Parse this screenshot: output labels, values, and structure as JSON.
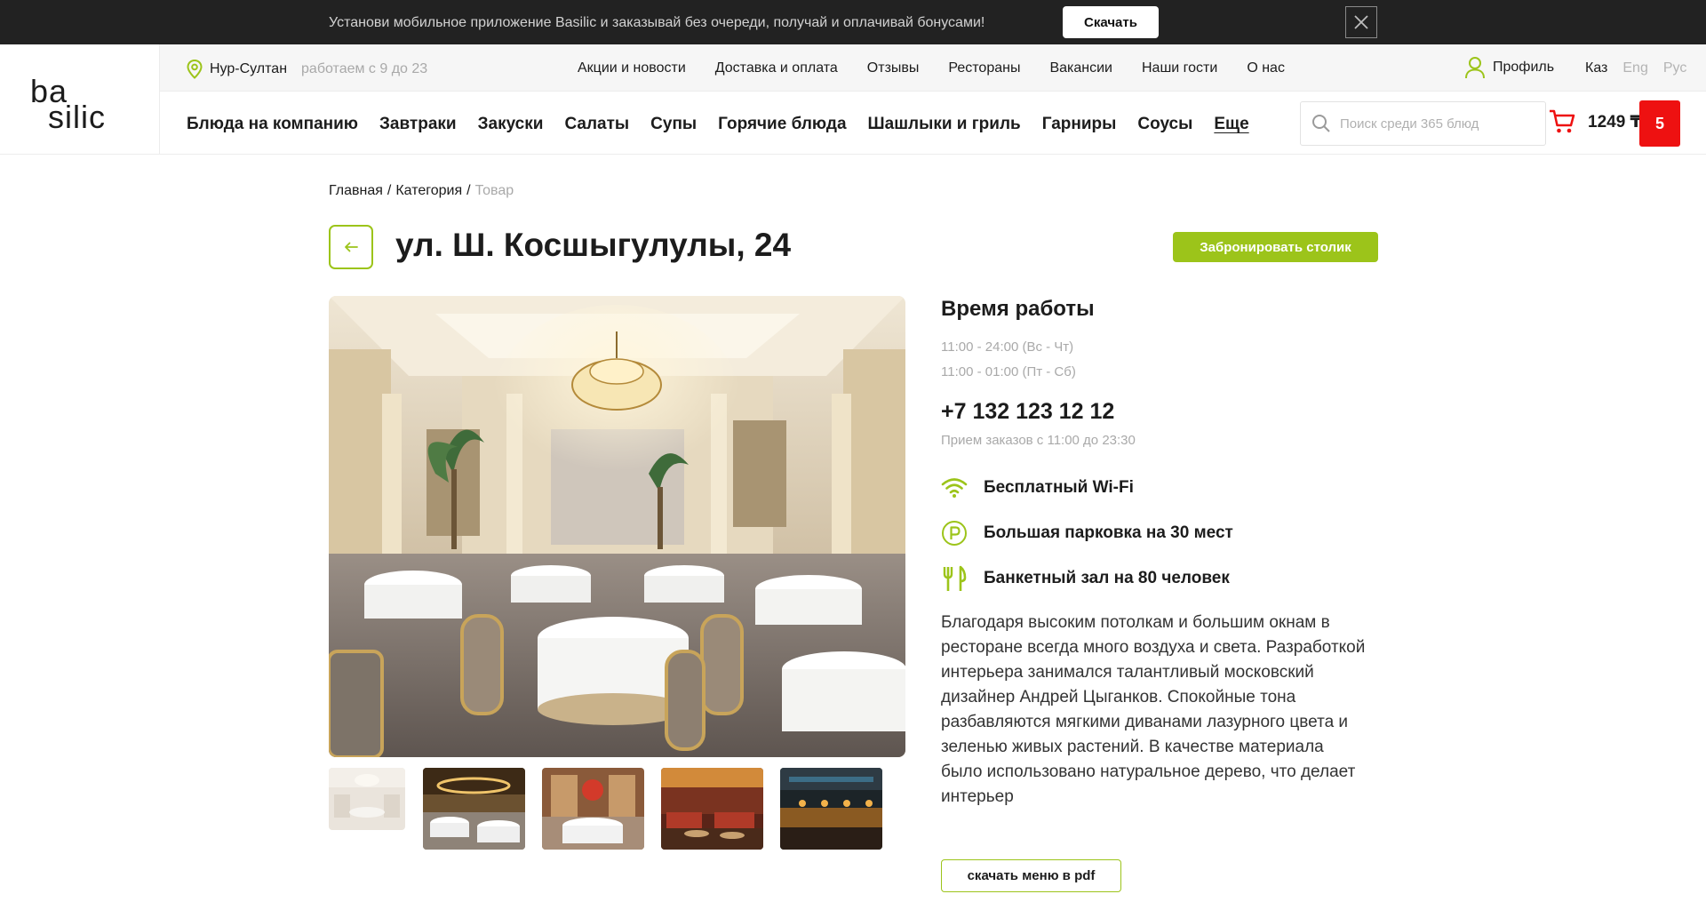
{
  "promo": {
    "text": "Установи мобильное приложение Basilic и заказывай без очереди, получай и оплачивай бонусами!",
    "button_label": "Скачать",
    "close_icon": "close-icon"
  },
  "logo": {
    "line1": "ba",
    "line2": "silic"
  },
  "topbar": {
    "city": "Нур-Султан",
    "hours": "работаем с 9 до 23",
    "nav": [
      "Акции и новости",
      "Доставка и оплата",
      "Отзывы",
      "Рестораны",
      "Вакансии",
      "Наши гости",
      "О нас"
    ],
    "profile_label": "Профиль",
    "languages": [
      "Каз",
      "Eng",
      "Рус"
    ],
    "active_language": "Каз"
  },
  "mainbar": {
    "categories": [
      "Блюда на компанию",
      "Завтраки",
      "Закуски",
      "Салаты",
      "Супы",
      "Горячие блюда",
      "Шашлыки и гриль",
      "Гарниры",
      "Соусы"
    ],
    "more_label": "Еще",
    "search_placeholder": "Поиск среди 365 блюд",
    "cart_sum": "1249 ₸",
    "cart_count": "5"
  },
  "breadcrumb": {
    "items": [
      "Главная",
      "Категория"
    ],
    "current": "Товар",
    "separator": "/"
  },
  "page": {
    "title": "ул. Ш. Косшыгулулы, 24",
    "book_label": "Забронировать столик"
  },
  "info": {
    "hours_title": "Время работы",
    "hours": [
      "11:00 - 24:00 (Вс - Чт)",
      "11:00 - 01:00 (Пт - Сб)"
    ],
    "phone": "+7 132 123 12 12",
    "phone_note": "Прием заказов с 11:00 до 23:30",
    "features": [
      {
        "icon": "wifi-icon",
        "label": "Бесплатный Wi-Fi"
      },
      {
        "icon": "parking-icon",
        "label": "Большая парковка на 30 мест"
      },
      {
        "icon": "fork-knife-icon",
        "label": "Банкетный зал на 80 человек"
      }
    ],
    "description": "Благодаря высоким потолкам и большим окнам в ресторане всегда много воздуха и света. Разработкой интерьера занимался талантливый московский дизайнер Андрей Цыганков. Спокойные тона разбавляются мягкими диванами лазурного цвета и зеленью живых растений. В качестве материала было использовано натуральное дерево, что делает интерьер",
    "pdf_label": "скачать меню в pdf"
  },
  "colors": {
    "accent": "#9cc41a",
    "cart_badge": "#ee1111",
    "promo_bg": "#222222",
    "muted_text": "#a9a9a9"
  }
}
